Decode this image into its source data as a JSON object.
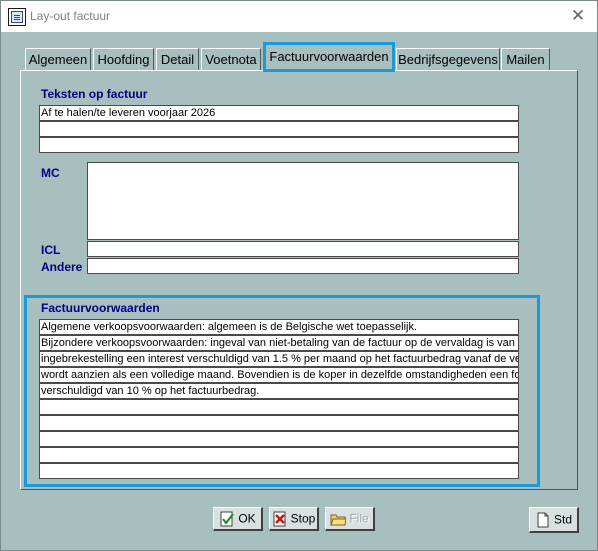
{
  "window": {
    "title": "Lay-out factuur",
    "close_glyph": "✕"
  },
  "tabs": [
    {
      "label": "Algemeen"
    },
    {
      "label": "Hoofding"
    },
    {
      "label": "Detail"
    },
    {
      "label": "Voetnota"
    },
    {
      "label": "Factuurvoorwaarden",
      "active": true
    },
    {
      "label": "Bedrijfsgegevens"
    },
    {
      "label": "Mailen"
    }
  ],
  "teksten": {
    "heading": "Teksten op factuur",
    "lines": [
      "Af te halen/te leveren voorjaar 2026",
      "",
      "",
      ""
    ]
  },
  "mc": {
    "label": "MC",
    "value": ""
  },
  "icl": {
    "label": "ICL",
    "value": ""
  },
  "andere": {
    "label": "Andere",
    "value": ""
  },
  "factuurvoorwaarden": {
    "heading": "Factuurvoorwaarden",
    "lines": [
      "Algemene verkoopsvoorwaarden: algemeen is de Belgische wet toepasselijk.",
      "Bijzondere verkoopsvoorwaarden: ingeval van niet-betaling van de factuur op de vervaldag is van",
      "ingebrekestelling een interest verschuldigd van 1.5 % per maand op het factuurbedrag vanaf de ve",
      "wordt aanzien als een volledige maand. Bovendien is de koper in dezelfde omstandigheden een for",
      "verschuldigd van 10 % op het factuurbedrag.",
      "",
      "",
      "",
      "",
      ""
    ]
  },
  "buttons": {
    "ok": {
      "label": "OK",
      "icon": "check-document-icon"
    },
    "stop": {
      "label": "Stop",
      "icon": "cancel-document-icon"
    },
    "file": {
      "label": "File",
      "icon": "folder-icon",
      "enabled": false
    },
    "std": {
      "label": "Std",
      "icon": "document-icon"
    }
  },
  "colors": {
    "highlight": "#1c9ad8",
    "label": "#000080",
    "background": "#a7bfbf"
  }
}
